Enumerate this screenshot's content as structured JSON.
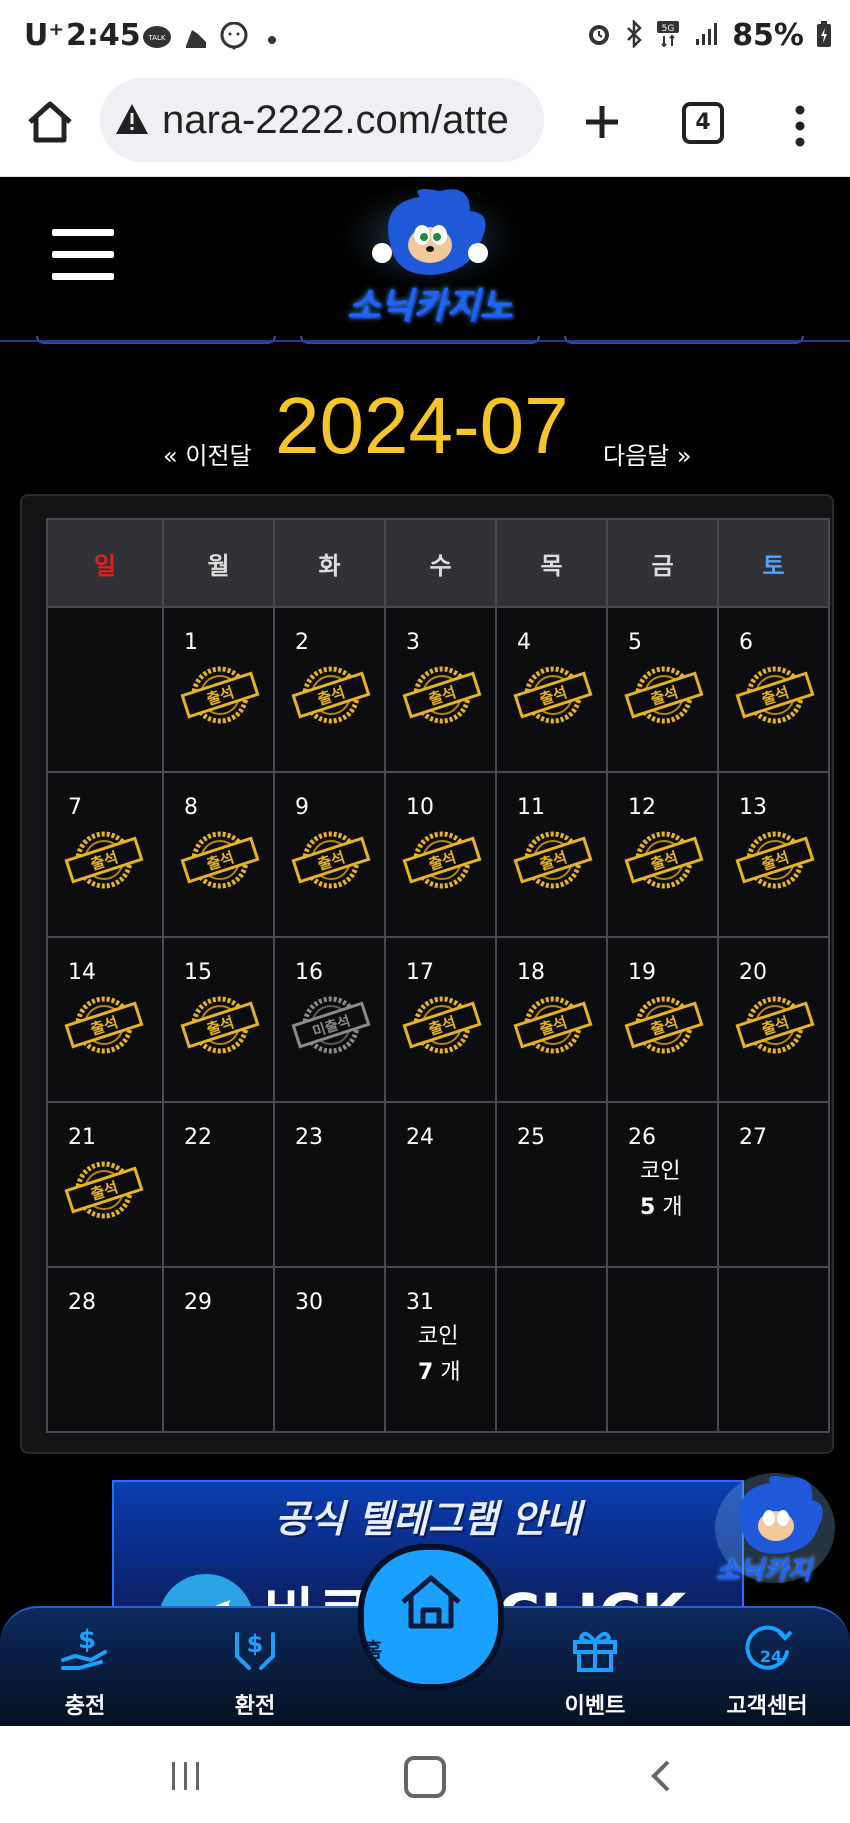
{
  "status_bar": {
    "carrier": "U⁺",
    "time": "2:45",
    "talk_badge": "TALK",
    "network": "5G",
    "battery": "85%"
  },
  "browser": {
    "url": "nara-2222.com/atte",
    "tab_count": "4"
  },
  "site": {
    "logo_text": "소닉카지노"
  },
  "month_nav": {
    "prev_label": "« 이전달",
    "month": "2024-07",
    "next_label": "다음달 »"
  },
  "calendar": {
    "weekdays": [
      "일",
      "월",
      "화",
      "수",
      "목",
      "금",
      "토"
    ],
    "attended_label": "출석",
    "missed_label": "미출석",
    "coin_label": "코인",
    "coin_unit": "개",
    "days": [
      {
        "day": "1",
        "status": "attended"
      },
      {
        "day": "2",
        "status": "attended"
      },
      {
        "day": "3",
        "status": "attended"
      },
      {
        "day": "4",
        "status": "attended"
      },
      {
        "day": "5",
        "status": "attended"
      },
      {
        "day": "6",
        "status": "attended"
      },
      {
        "day": "7",
        "status": "attended"
      },
      {
        "day": "8",
        "status": "attended"
      },
      {
        "day": "9",
        "status": "attended"
      },
      {
        "day": "10",
        "status": "attended"
      },
      {
        "day": "11",
        "status": "attended"
      },
      {
        "day": "12",
        "status": "attended"
      },
      {
        "day": "13",
        "status": "attended"
      },
      {
        "day": "14",
        "status": "attended"
      },
      {
        "day": "15",
        "status": "attended"
      },
      {
        "day": "16",
        "status": "missed"
      },
      {
        "day": "17",
        "status": "attended"
      },
      {
        "day": "18",
        "status": "attended"
      },
      {
        "day": "19",
        "status": "attended"
      },
      {
        "day": "20",
        "status": "attended"
      },
      {
        "day": "21",
        "status": "attended"
      },
      {
        "day": "22",
        "status": "none"
      },
      {
        "day": "23",
        "status": "none"
      },
      {
        "day": "24",
        "status": "none"
      },
      {
        "day": "25",
        "status": "none"
      },
      {
        "day": "26",
        "status": "coin",
        "coins": "5"
      },
      {
        "day": "27",
        "status": "none"
      },
      {
        "day": "28",
        "status": "none"
      },
      {
        "day": "29",
        "status": "none"
      },
      {
        "day": "30",
        "status": "none"
      },
      {
        "day": "31",
        "status": "coin",
        "coins": "7"
      }
    ]
  },
  "banner": {
    "title": "공식 텔레그램 안내",
    "subtitle": "바로가기 CLICK",
    "mascot_text": "소닉카지"
  },
  "bottom_nav": {
    "deposit": "충전",
    "withdraw": "환전",
    "home": "홈",
    "event": "이벤트",
    "support": "고객센터"
  },
  "colors": {
    "month_gold": "#f6c629",
    "sunday_red": "#e02020",
    "saturday_blue": "#4fa5ff",
    "accent_blue": "#1aa0ff"
  }
}
